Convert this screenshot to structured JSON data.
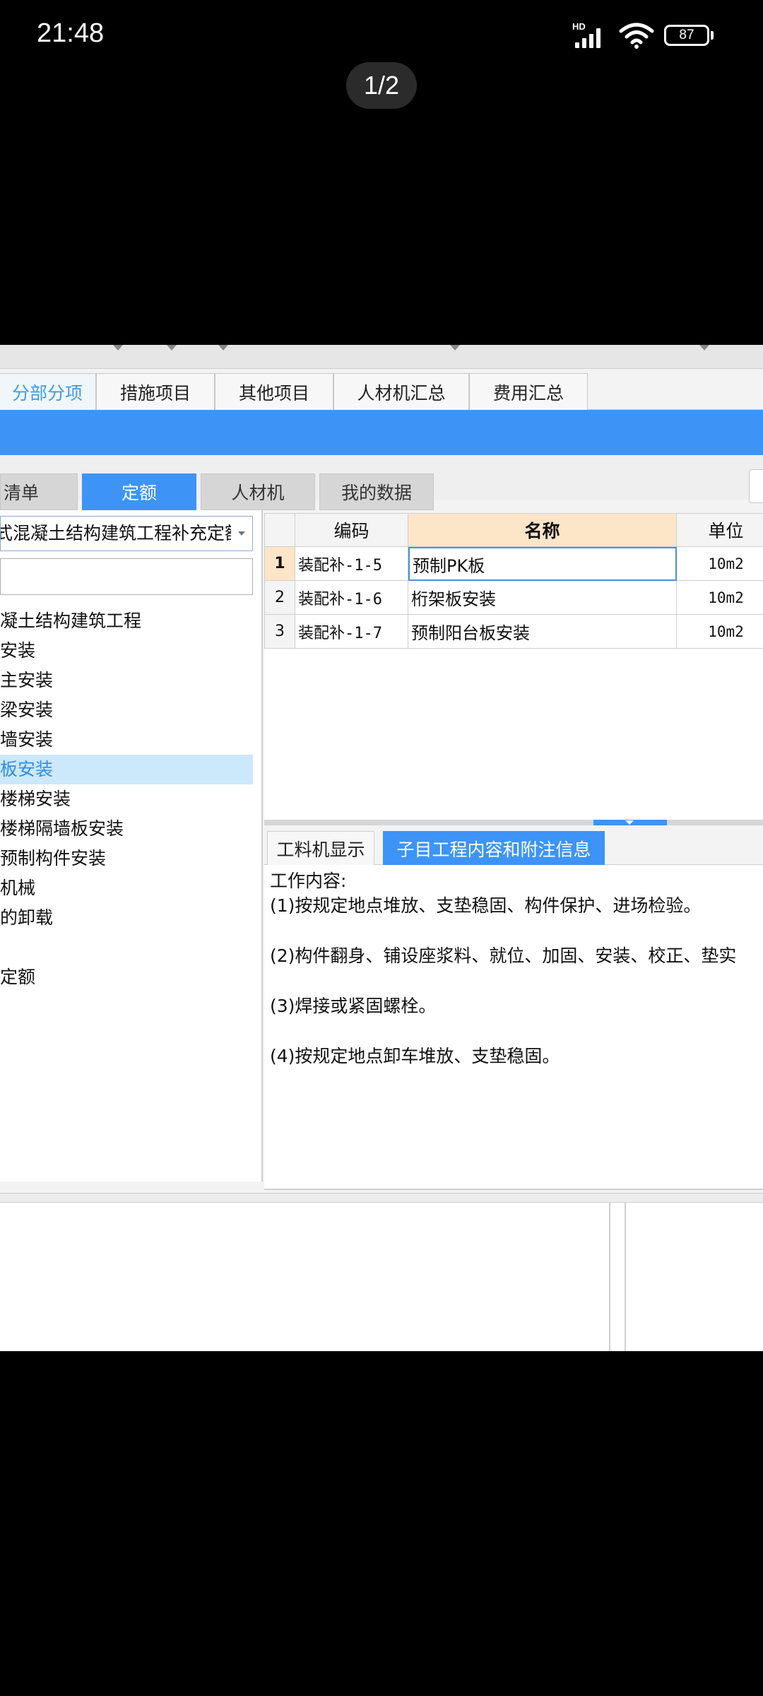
{
  "status_bar": {
    "time": "21:48",
    "network_label": "HD",
    "battery": "87"
  },
  "viewer": {
    "page_counter": "1/2"
  },
  "main_tabs": [
    {
      "label": "分部分项",
      "active": true
    },
    {
      "label": "措施项目",
      "active": false
    },
    {
      "label": "其他项目",
      "active": false
    },
    {
      "label": "人材机汇总",
      "active": false
    },
    {
      "label": "费用汇总",
      "active": false
    }
  ],
  "sub_tabs": [
    {
      "label": "清单",
      "active": false
    },
    {
      "label": "定额",
      "active": true
    },
    {
      "label": "人材机",
      "active": false
    },
    {
      "label": "我的数据",
      "active": false
    }
  ],
  "library": {
    "selected": "式混凝土结构建筑工程补充定额",
    "search_value": ""
  },
  "tree": [
    {
      "label": "凝土结构建筑工程",
      "selected": false
    },
    {
      "label": "安装",
      "selected": false
    },
    {
      "label": "主安装",
      "selected": false
    },
    {
      "label": "梁安装",
      "selected": false
    },
    {
      "label": "墙安装",
      "selected": false
    },
    {
      "label": "板安装",
      "selected": true
    },
    {
      "label": "楼梯安装",
      "selected": false
    },
    {
      "label": "楼梯隔墙板安装",
      "selected": false
    },
    {
      "label": "预制构件安装",
      "selected": false
    },
    {
      "label": "机械",
      "selected": false
    },
    {
      "label": "的卸载",
      "selected": false
    },
    {
      "label": "",
      "selected": false
    },
    {
      "label": "定额",
      "selected": false
    }
  ],
  "grid": {
    "headers": {
      "index": "",
      "code": "编码",
      "name": "名称",
      "unit": "单位"
    },
    "rows": [
      {
        "index": "1",
        "code": "装配补-1-5",
        "name": "预制PK板",
        "unit": "10m2"
      },
      {
        "index": "2",
        "code": "装配补-1-6",
        "name": "桁架板安装",
        "unit": "10m2"
      },
      {
        "index": "3",
        "code": "装配补-1-7",
        "name": "预制阳台板安装",
        "unit": "10m2"
      }
    ]
  },
  "detail_tabs": [
    {
      "label": "工料机显示",
      "active": false
    },
    {
      "label": "子目工程内容和附注信息",
      "active": true
    }
  ],
  "detail": {
    "title": "工作内容:",
    "items": [
      "(1)按规定地点堆放、支垫稳固、构件保护、进场检验。",
      "(2)构件翻身、铺设座浆料、就位、加固、安装、校正、垫实",
      "(3)焊接或紧固螺栓。",
      "(4)按规定地点卸车堆放、支垫稳固。"
    ]
  },
  "colors": {
    "accent_blue": "#3d94f6",
    "selection_blue": "#cce8fb",
    "header_highlight": "#fde5c8"
  }
}
